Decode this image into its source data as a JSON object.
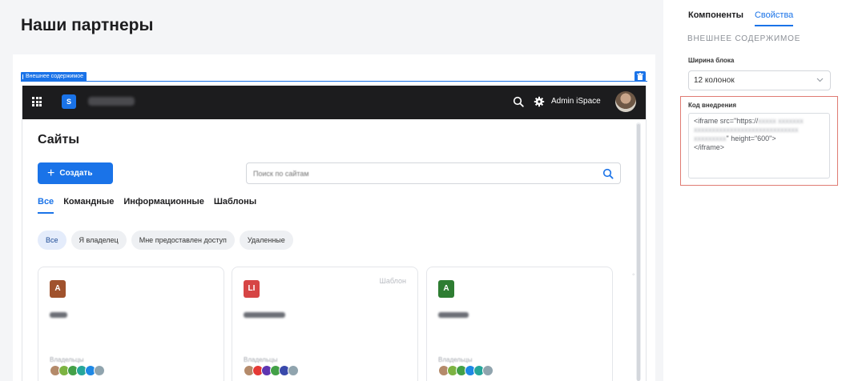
{
  "page": {
    "title": "Наши партнеры"
  },
  "block": {
    "tag": "Внешнее содержимое"
  },
  "app": {
    "logo_letter": "S",
    "user_name": "Admin iSpace",
    "heading": "Сайты",
    "create_label": "Создать",
    "search_placeholder": "Поиск по сайтам",
    "tabs": [
      {
        "label": "Все"
      },
      {
        "label": "Командные"
      },
      {
        "label": "Информационные"
      },
      {
        "label": "Шаблоны"
      }
    ],
    "filters": [
      {
        "label": "Все"
      },
      {
        "label": "Я владелец"
      },
      {
        "label": "Мне предоставлен доступ"
      },
      {
        "label": "Удаленные"
      }
    ],
    "cards": [
      {
        "letter": "A",
        "color": "#a0522d",
        "template_badge": "",
        "owners_label": "Владельцы"
      },
      {
        "letter": "LI",
        "color": "#d64545",
        "template_badge": "Шаблон",
        "owners_label": "Владельцы"
      },
      {
        "letter": "A",
        "color": "#2e7d32",
        "template_badge": "",
        "owners_label": "Владельцы"
      }
    ]
  },
  "panel": {
    "tabs": [
      {
        "label": "Компоненты"
      },
      {
        "label": "Свойства"
      }
    ],
    "section_title": "ВНЕШНЕЕ СОДЕРЖИМОЕ",
    "width_label": "Ширина блока",
    "width_value": "12 колонок",
    "embed_label": "Код внедрения",
    "code_start": "<iframe src=\"https://",
    "code_end": "\" height=\"600\">",
    "code_close": "</iframe>"
  },
  "colors": {
    "accent": "#1a73e8",
    "topbar": "#1c1c1e",
    "highlight_border": "#e07b73"
  }
}
